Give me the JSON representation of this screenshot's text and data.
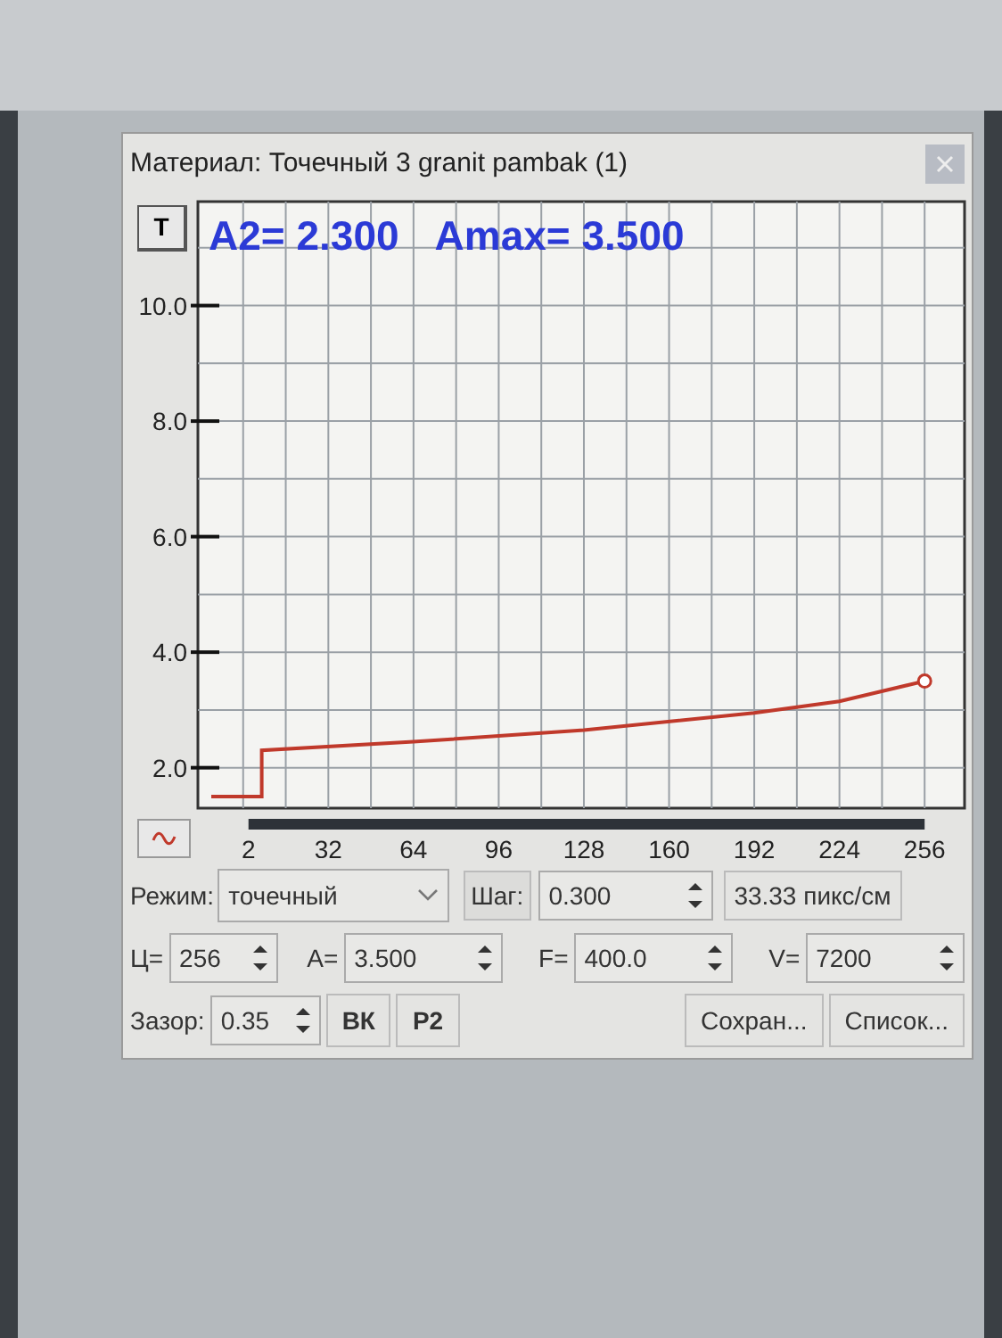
{
  "window": {
    "title": "Материал: Точечный 3 granit pambak (1)"
  },
  "chart": {
    "toggle_button": "T",
    "a2_reading": "A2= 2.300",
    "amax_reading": "Amax= 3.500",
    "chart_data": {
      "type": "line",
      "grid": true,
      "xlim": [
        -17,
        271
      ],
      "ylim": [
        1.3,
        11.8
      ],
      "xticks": [
        2,
        32,
        64,
        96,
        128,
        160,
        192,
        224,
        256
      ],
      "yticks": [
        {
          "value": 2,
          "label": "2.0"
        },
        {
          "value": 4,
          "label": "4.0"
        },
        {
          "value": 6,
          "label": "6.0"
        },
        {
          "value": 8,
          "label": "8.0"
        },
        {
          "value": 10,
          "label": "10.0"
        }
      ],
      "x": [
        -12,
        7,
        7,
        64,
        128,
        192,
        224,
        256
      ],
      "series": [
        {
          "color": "#c0392b",
          "values": [
            1.5,
            1.5,
            2.3,
            2.45,
            2.65,
            2.95,
            3.15,
            3.5
          ]
        }
      ]
    }
  },
  "controls": {
    "mode_label": "Режим:",
    "mode_value": "точечный",
    "step_label": "Шаг:",
    "step_value": "0.300",
    "scale_reading": "33.33 пикс/см",
    "c_label": "Ц=",
    "c_value": "256",
    "a_label": "A=",
    "a_value": "3.500",
    "f_label": "F=",
    "f_value": "400.0",
    "v_label": "V=",
    "v_value": "7200",
    "gap_label": "Зазор:",
    "gap_value": "0.35",
    "buttons": [
      "ВК",
      "Р2",
      "Сохран...",
      "Список..."
    ]
  }
}
